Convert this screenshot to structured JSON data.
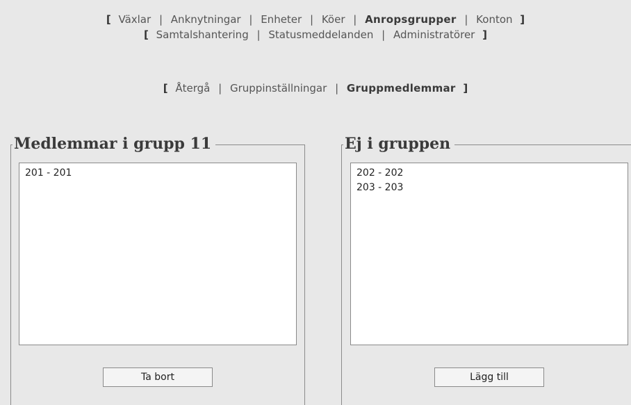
{
  "nav_primary": [
    {
      "label": "Växlar",
      "active": false
    },
    {
      "label": "Anknytningar",
      "active": false
    },
    {
      "label": "Enheter",
      "active": false
    },
    {
      "label": "Köer",
      "active": false
    },
    {
      "label": "Anropsgrupper",
      "active": true
    },
    {
      "label": "Konton",
      "active": false
    }
  ],
  "nav_secondary": [
    {
      "label": "Samtalshantering",
      "active": false
    },
    {
      "label": "Statusmeddelanden",
      "active": false
    },
    {
      "label": "Administratörer",
      "active": false
    }
  ],
  "nav_sub": [
    {
      "label": "Återgå",
      "active": false
    },
    {
      "label": "Gruppinställningar",
      "active": false
    },
    {
      "label": "Gruppmedlemmar",
      "active": true
    }
  ],
  "brackets": {
    "open": "[",
    "close": "]",
    "separator": "|"
  },
  "members": {
    "title": "Medlemmar i grupp 11",
    "items": [
      "201 - 201"
    ],
    "button_label": "Ta bort"
  },
  "non_members": {
    "title": "Ej i gruppen",
    "items": [
      "202 - 202",
      "203 - 203"
    ],
    "button_label": "Lägg till"
  }
}
